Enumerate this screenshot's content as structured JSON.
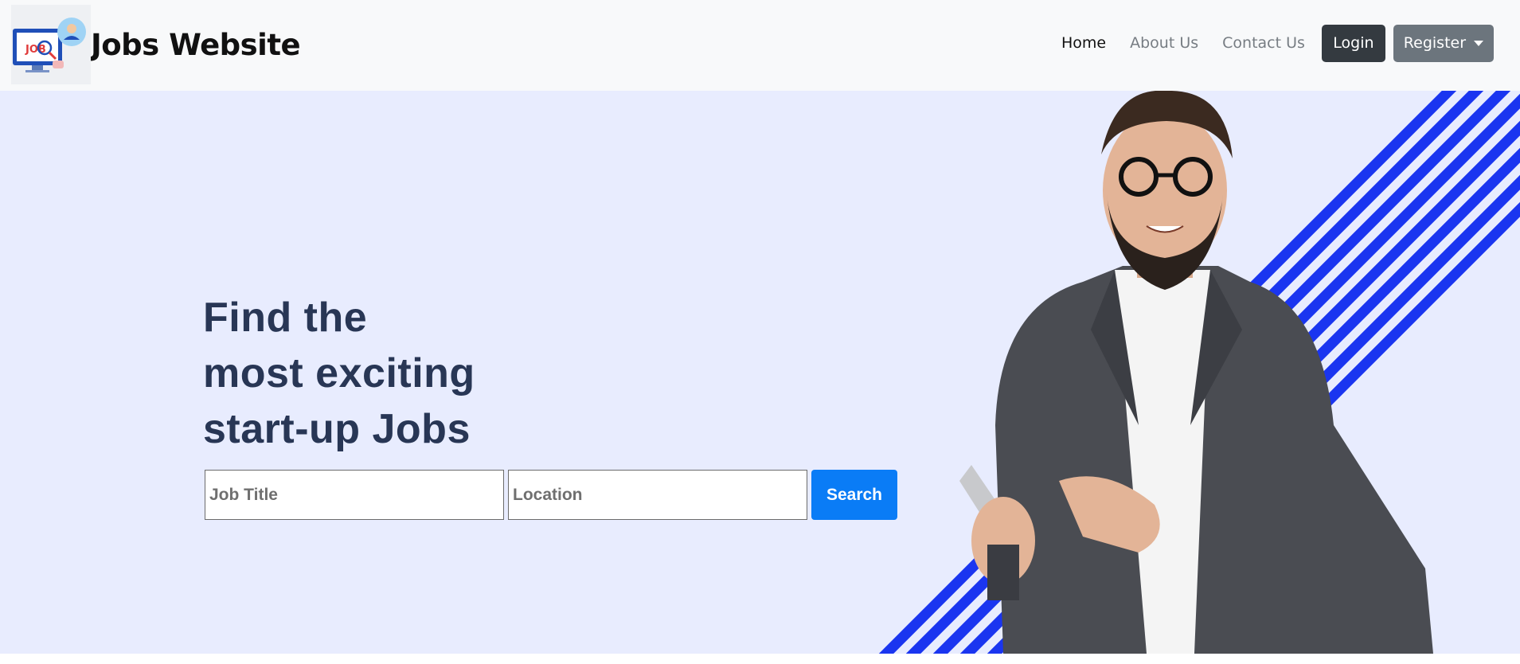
{
  "navbar": {
    "brand_name": "Jobs Website",
    "brand_logo_text": "JOB",
    "links": [
      {
        "label": "Home",
        "active": true
      },
      {
        "label": "About Us",
        "active": false
      },
      {
        "label": "Contact Us",
        "active": false
      }
    ],
    "login_label": "Login",
    "register_label": "Register"
  },
  "hero": {
    "headline_lines": [
      "Find the",
      "most exciting",
      "start-up Jobs"
    ],
    "search": {
      "job_title_placeholder": "Job Title",
      "location_placeholder": "Location",
      "button_label": "Search"
    }
  },
  "colors": {
    "navbar_bg": "#f8f9fa",
    "hero_bg": "#e8ecfe",
    "headline": "#283655",
    "stripe_blue": "#1a35f0",
    "search_button": "#0a7cf6",
    "login_button": "#343a40",
    "register_button": "#6c757d"
  }
}
